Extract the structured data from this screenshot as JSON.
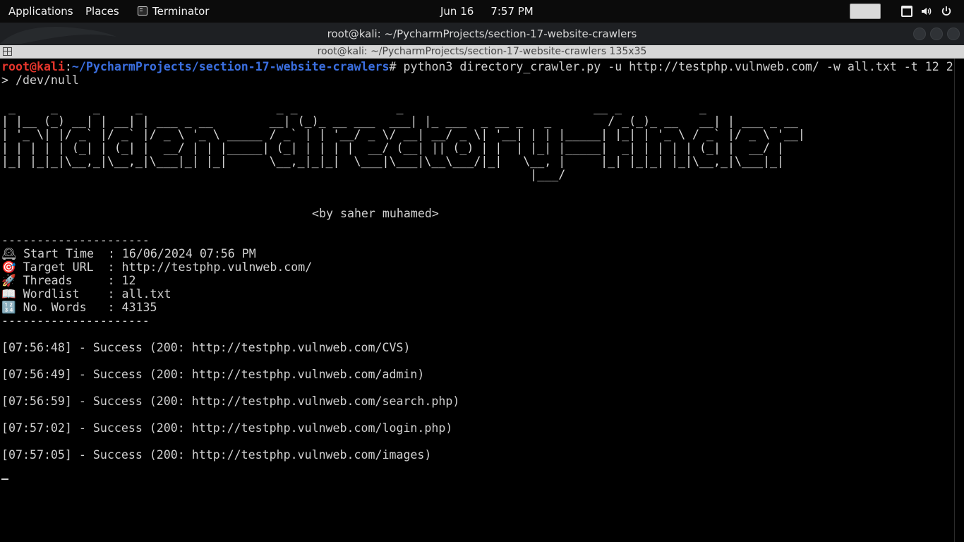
{
  "topbar": {
    "applications_label": "Applications",
    "places_label": "Places",
    "active_app_label": "Terminator",
    "date": "Jun 16",
    "time": "7:57 PM",
    "icons": [
      "keyboard-layout-icon",
      "network-icon",
      "volume-icon",
      "power-icon"
    ]
  },
  "window": {
    "title": "root@kali: ~/PycharmProjects/section-17-website-crawlers",
    "terminator_title": "root@kali: ~/PycharmProjects/section-17-website-crawlers 135x35"
  },
  "terminal": {
    "prompt_user": "root@kali",
    "prompt_sep": ":",
    "prompt_path": "~/PycharmProjects/section-17-website-crawlers",
    "prompt_symbol": "# ",
    "command_line1": "python3 directory_crawler.py -u http://testphp.vulnweb.com/ -w all.txt -t 12 2",
    "command_line2": "> /dev/null",
    "banner_ascii": " _     _     _     _                   _ _              _                           __ _           _\n| |__ (_) __| | __| | ___ _ __        __| (_)_ __ ___  ___| |_ ___  _ __ _   _        / _(_)_ __   __| | ___ _ __\n| '_ \\| |/ _` |/ _` |/ _ \\ '_ \\ _____ / _` | | '__/ _ \\/ __| __/ _ \\| '__| | | |_____| |_| | '_ \\ / _` |/ _ \\ '__|\n| | | | | (_| | (_| |  __/ | | |_____| (_| | | | |  __/ (__| || (_) | |  | |_| |_____|  _| | | | | (_| |  __/ |\n|_| |_|_|\\__,_|\\__,_|\\___|_| |_|      \\__,_|_|_|  \\___|\\___|\\__\\___/|_|   \\__, |     |_| |_|_| |_|\\__,_|\\___|_|\n                                                                           |___/",
    "byline": "<by saher muhamed>",
    "separator": "---------------------",
    "info": [
      {
        "icon": "🕰",
        "label": "Start Time  : 16/06/2024 07:56 PM"
      },
      {
        "icon": "🎯",
        "label": "Target URL  : http://testphp.vulnweb.com/"
      },
      {
        "icon": "🚀",
        "label": "Threads     : 12"
      },
      {
        "icon": "📖",
        "label": "Wordlist    : all.txt"
      },
      {
        "icon": "🔢",
        "label": "No. Words   : 43135"
      }
    ],
    "results": [
      "[07:56:48] - Success (200: http://testphp.vulnweb.com/CVS)",
      "[07:56:49] - Success (200: http://testphp.vulnweb.com/admin)",
      "[07:56:59] - Success (200: http://testphp.vulnweb.com/search.php)",
      "[07:57:02] - Success (200: http://testphp.vulnweb.com/login.php)",
      "[07:57:05] - Success (200: http://testphp.vulnweb.com/images)"
    ]
  },
  "colors": {
    "prompt_user": "#e5352c",
    "prompt_path": "#3b6fe0",
    "terminal_bg": "#000000",
    "terminal_fg": "#d0d0d0"
  }
}
